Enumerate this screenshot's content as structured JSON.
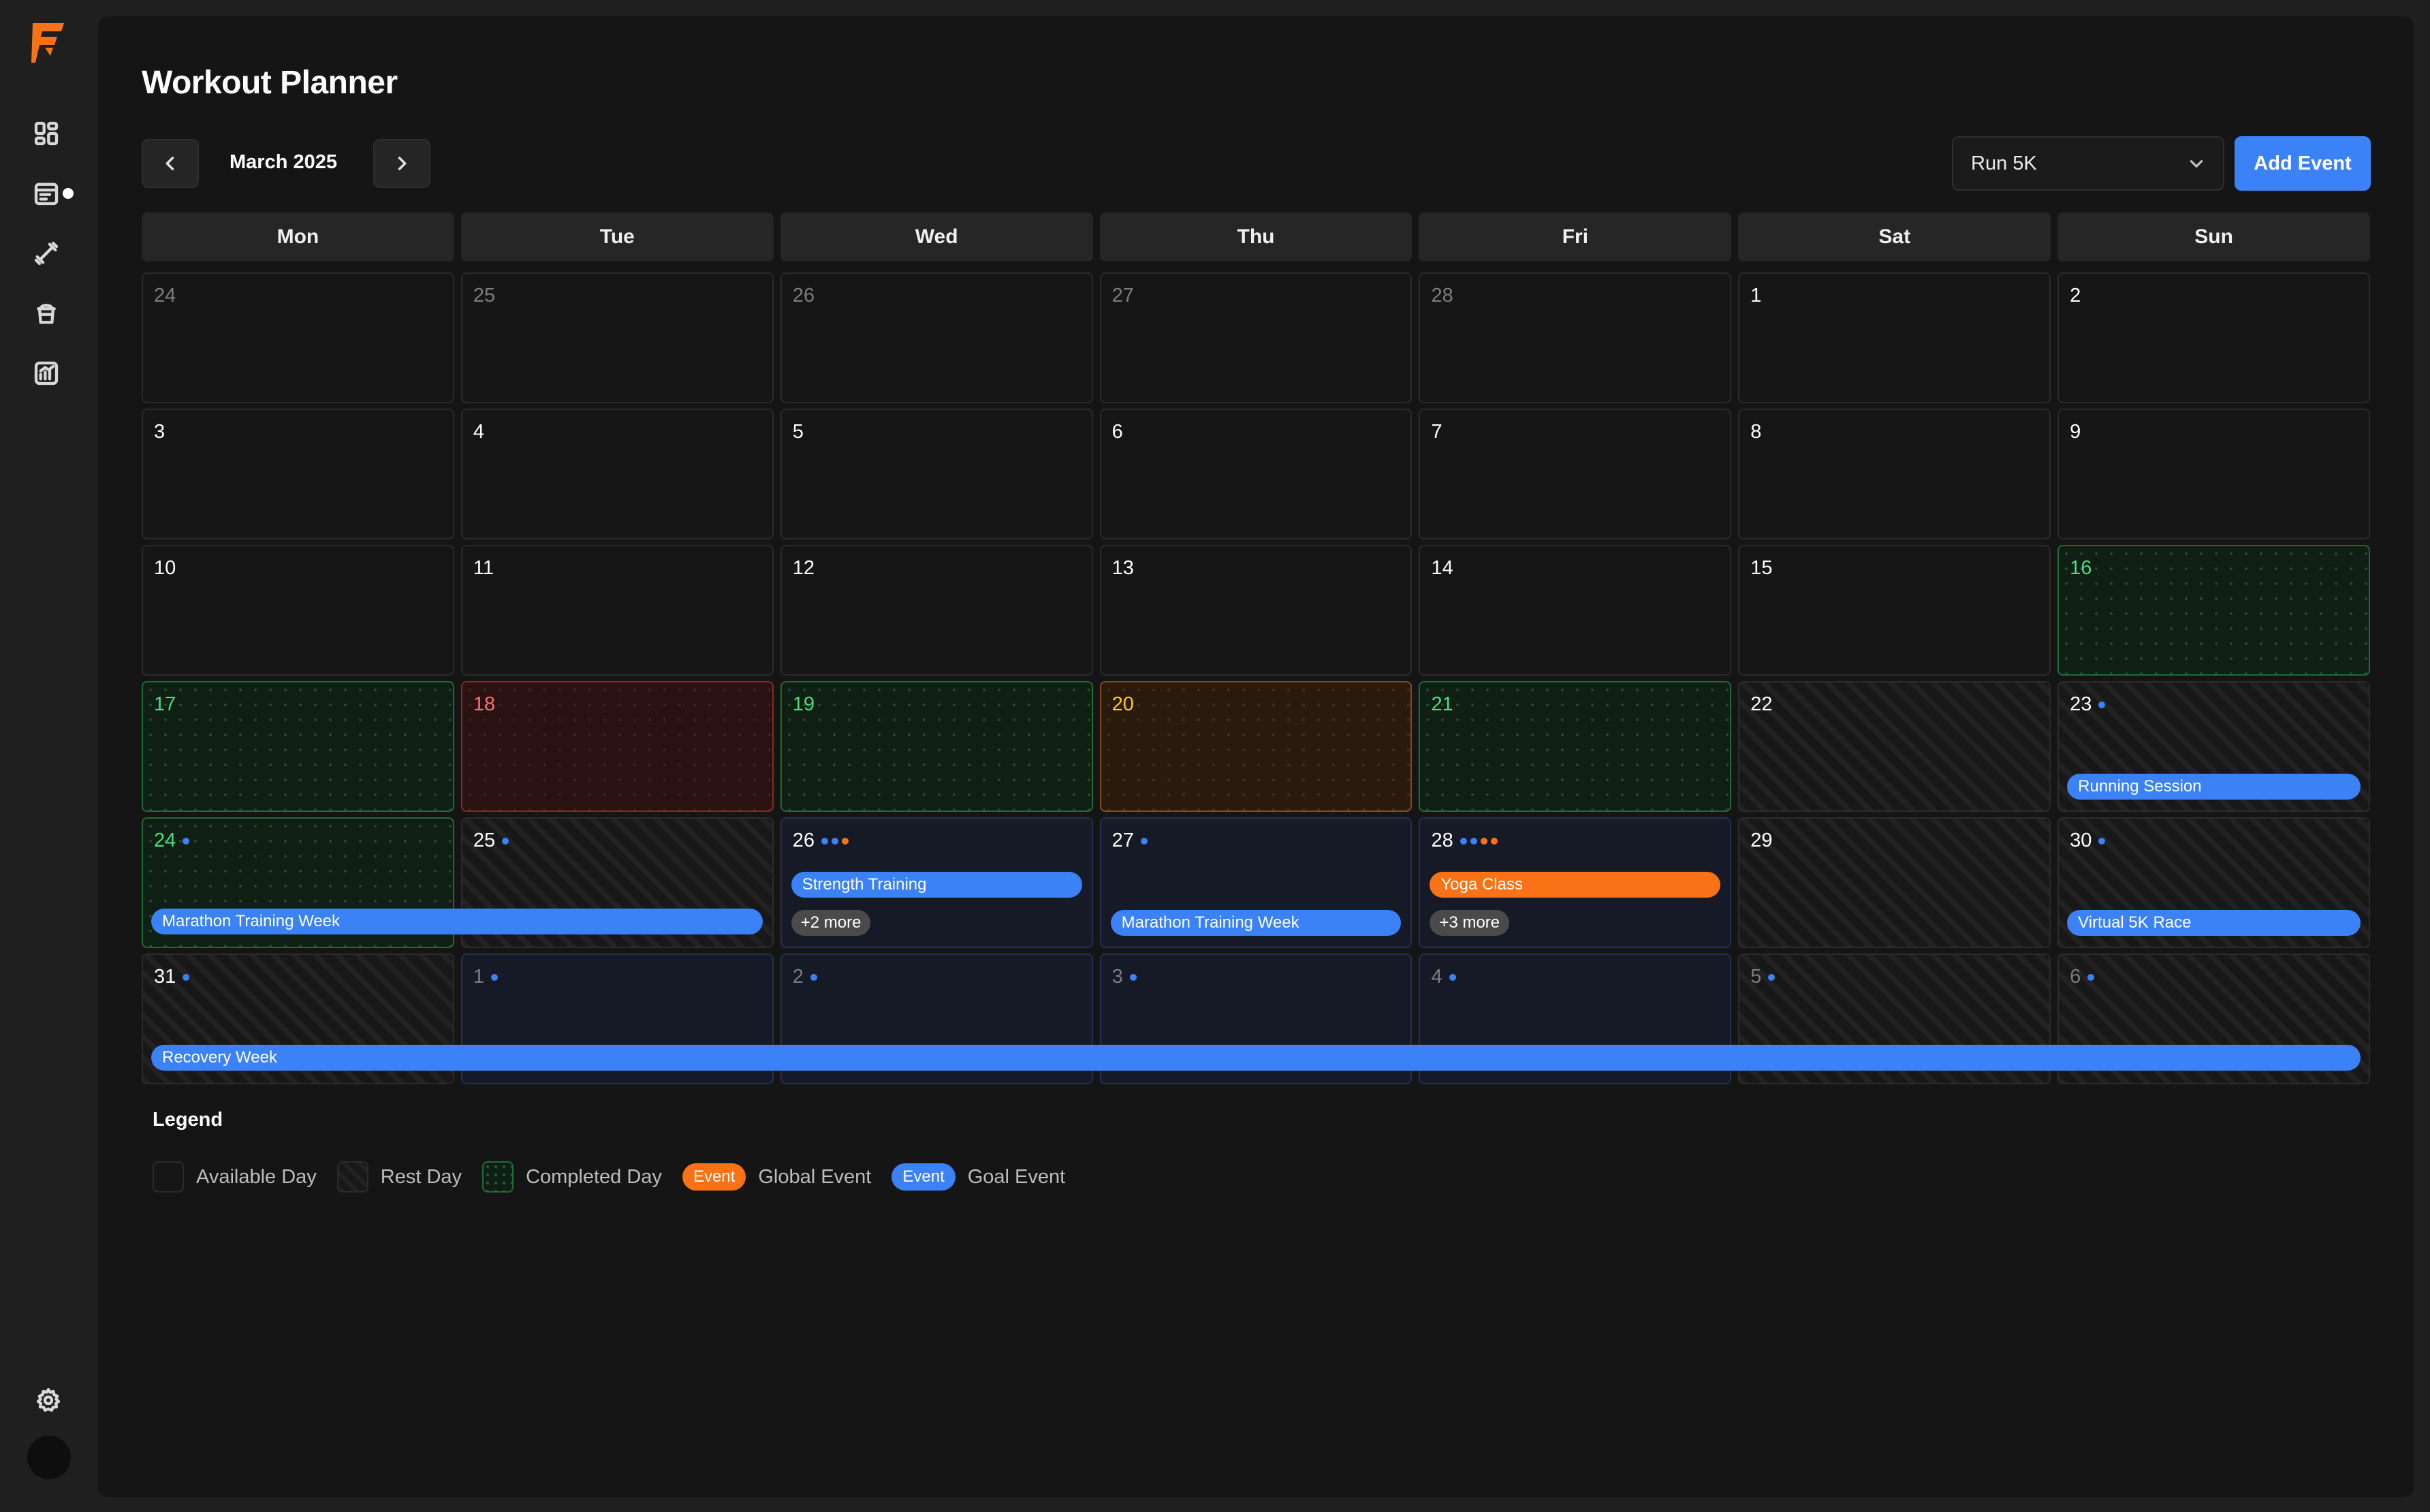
{
  "app": {
    "title": "Workout Planner"
  },
  "sidebar": {
    "icons": [
      "dashboard-icon",
      "calendar-icon",
      "dumbbell-icon",
      "nutrition-icon",
      "analytics-icon",
      "settings-icon"
    ]
  },
  "toolbar": {
    "month": "March 2025",
    "goal_select": "Run 5K",
    "add_event_label": "Add Event"
  },
  "calendar": {
    "weekdays": [
      "Mon",
      "Tue",
      "Wed",
      "Thu",
      "Fri",
      "Sat",
      "Sun"
    ],
    "weeks": [
      [
        "24",
        "25",
        "26",
        "27",
        "28",
        "1",
        "2"
      ],
      [
        "3",
        "4",
        "5",
        "6",
        "7",
        "8",
        "9"
      ],
      [
        "10",
        "11",
        "12",
        "13",
        "14",
        "15",
        "16"
      ],
      [
        "17",
        "18",
        "19",
        "20",
        "21",
        "22",
        "23"
      ],
      [
        "24",
        "25",
        "26",
        "27",
        "28",
        "29",
        "30"
      ],
      [
        "31",
        "1",
        "2",
        "3",
        "4",
        "5",
        "6"
      ]
    ],
    "events": {
      "running_session": "Running Session",
      "marathon_week_1": "Marathon Training Week",
      "strength_training": "Strength Training",
      "more_wed": "+2 more",
      "marathon_week_2": "Marathon Training Week",
      "yoga_class": "Yoga Class",
      "more_fri": "+3 more",
      "virtual_race": "Virtual 5K Race",
      "recovery_week": "Recovery Week"
    }
  },
  "legend": {
    "title": "Legend",
    "available": "Available Day",
    "rest": "Rest Day",
    "completed": "Completed Day",
    "badge_text": "Event",
    "global": "Global Event",
    "goal": "Goal Event"
  },
  "colors": {
    "accent_blue": "#3b82f6",
    "accent_orange": "#f97316",
    "completed_green": "#4ade80",
    "missed_red": "#f87171",
    "partial_yellow": "#facc15"
  }
}
